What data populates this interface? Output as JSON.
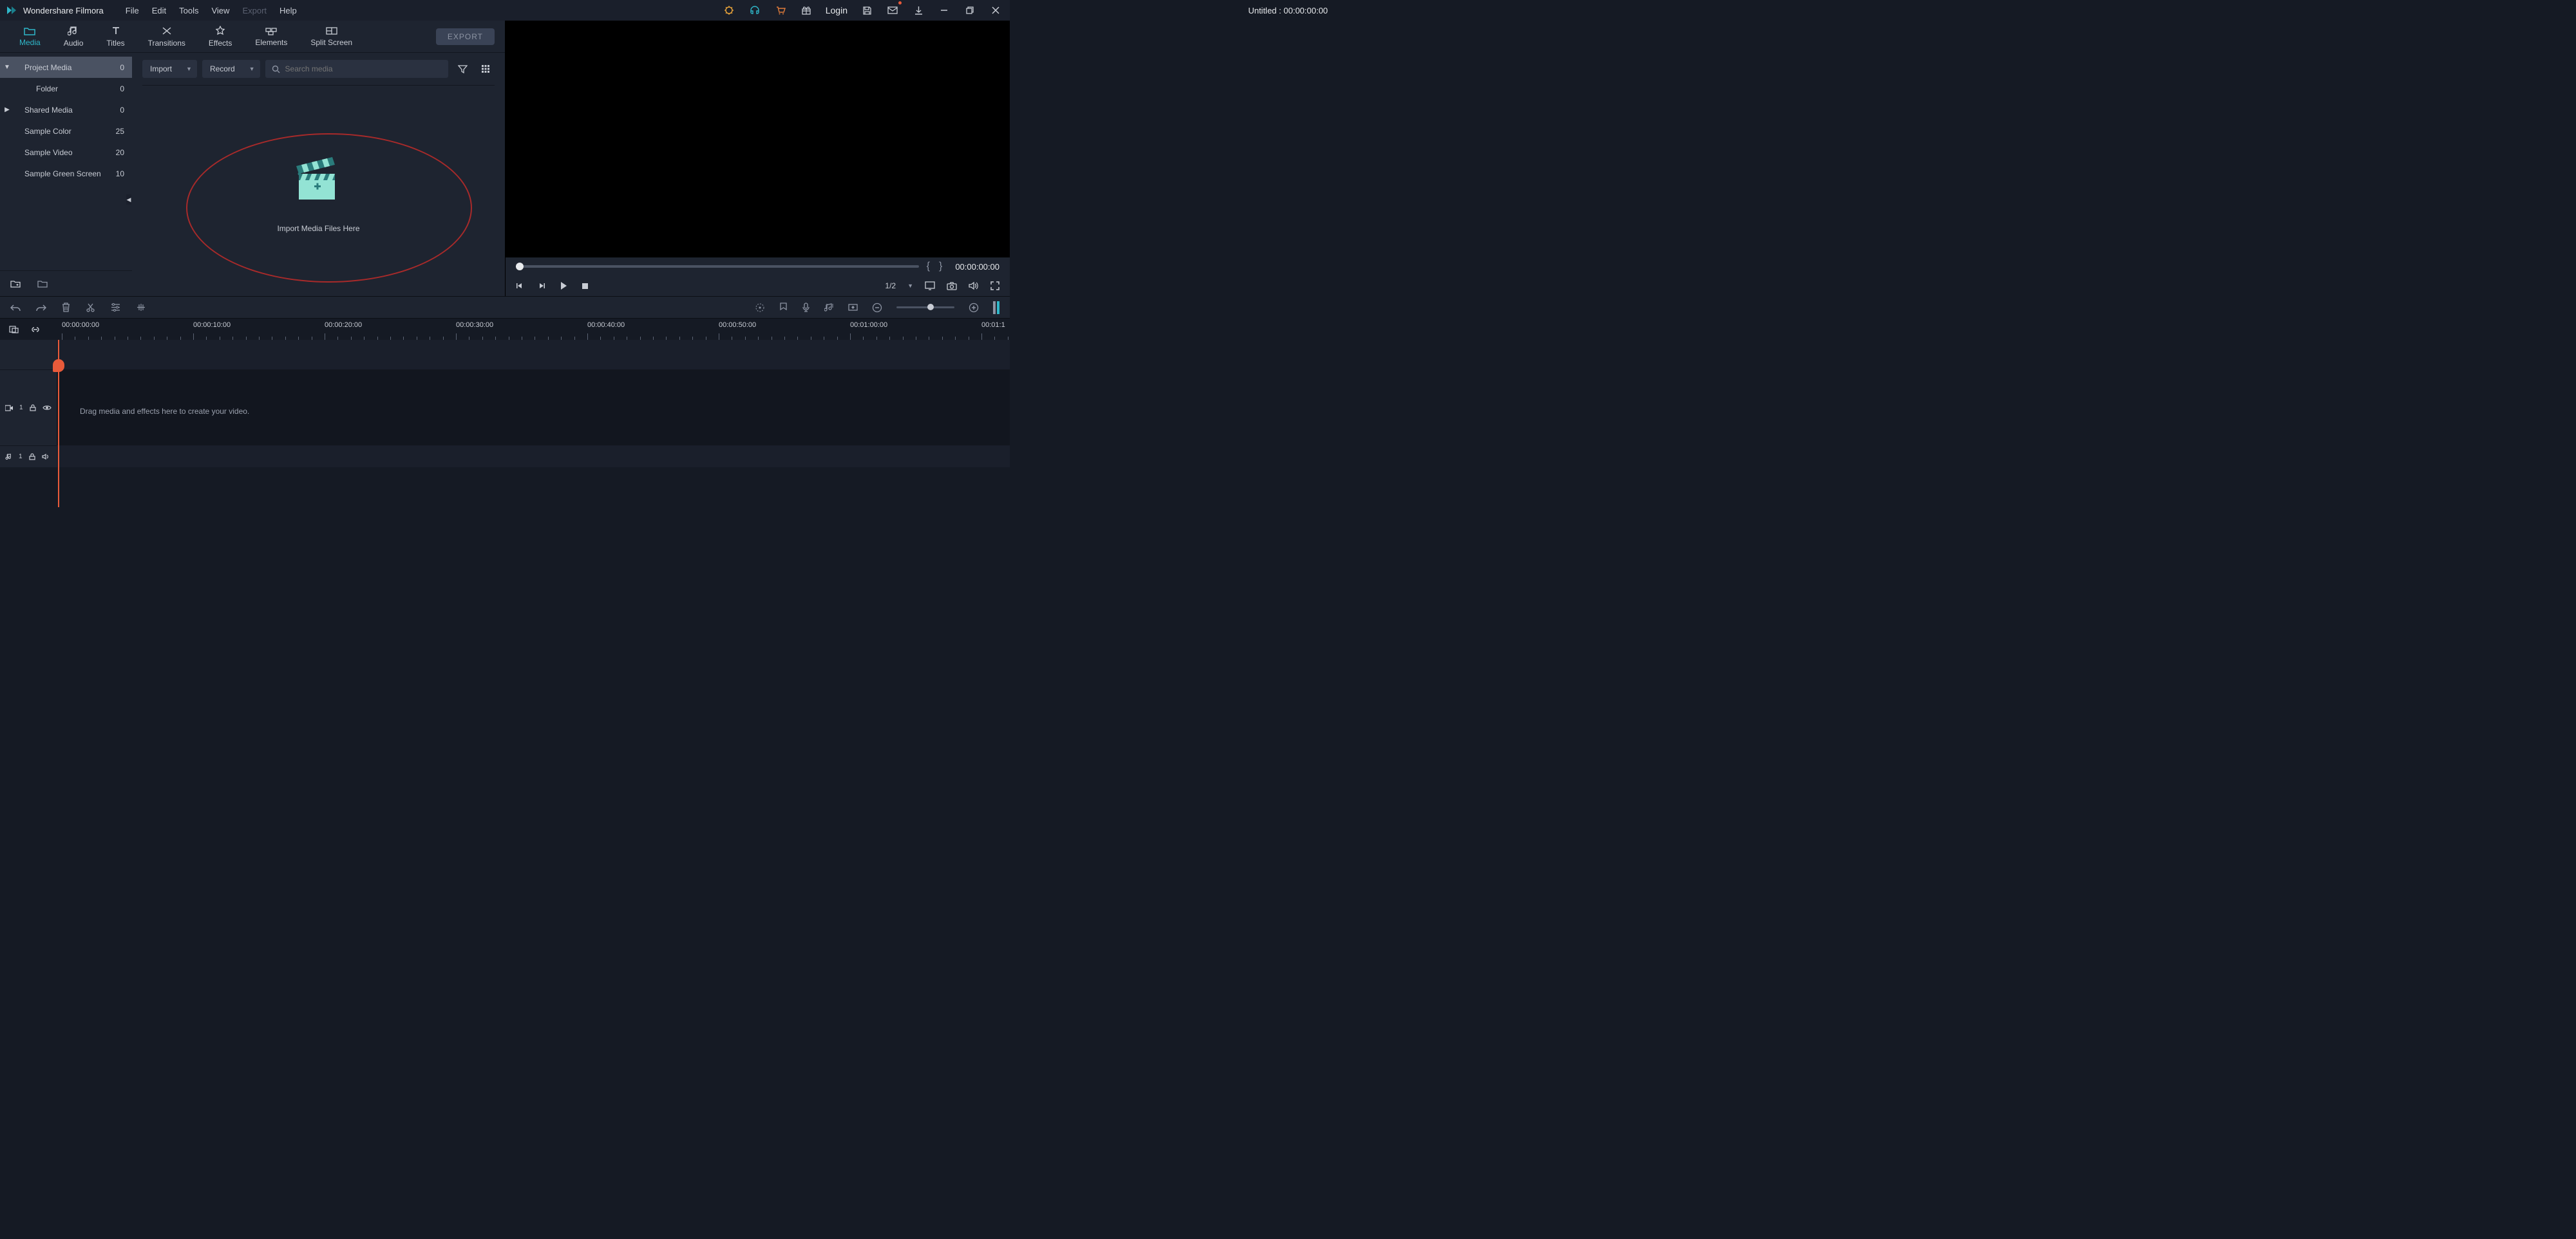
{
  "app_name": "Wondershare Filmora",
  "menu": {
    "file": "File",
    "edit": "Edit",
    "tools": "Tools",
    "view": "View",
    "export": "Export",
    "help": "Help"
  },
  "title_center": "Untitled : 00:00:00:00",
  "login_label": "Login",
  "tabs": {
    "media": "Media",
    "audio": "Audio",
    "titles": "Titles",
    "transitions": "Transitions",
    "effects": "Effects",
    "elements": "Elements",
    "split": "Split Screen"
  },
  "export_btn": "EXPORT",
  "sidebar": {
    "items": [
      {
        "label": "Project Media",
        "count": "0",
        "expandable": true,
        "expanded": true,
        "active": true
      },
      {
        "label": "Folder",
        "count": "0",
        "indent": true
      },
      {
        "label": "Shared Media",
        "count": "0",
        "expandable": true
      },
      {
        "label": "Sample Color",
        "count": "25"
      },
      {
        "label": "Sample Video",
        "count": "20"
      },
      {
        "label": "Sample Green Screen",
        "count": "10"
      }
    ]
  },
  "media_toolbar": {
    "import": "Import",
    "record": "Record",
    "search_placeholder": "Search media"
  },
  "drop_hint": "Import Media Files Here",
  "preview": {
    "timecode": "00:00:00:00",
    "ratio": "1/2"
  },
  "ruler": {
    "labels": [
      "00:00:00:00",
      "00:00:10:00",
      "00:00:20:00",
      "00:00:30:00",
      "00:00:40:00",
      "00:00:50:00",
      "00:01:00:00",
      "00:01:1"
    ]
  },
  "tracks": {
    "video_label_prefix": "",
    "video_num": "1",
    "audio_num": "1",
    "drop_hint": "Drag media and effects here to create your video."
  }
}
